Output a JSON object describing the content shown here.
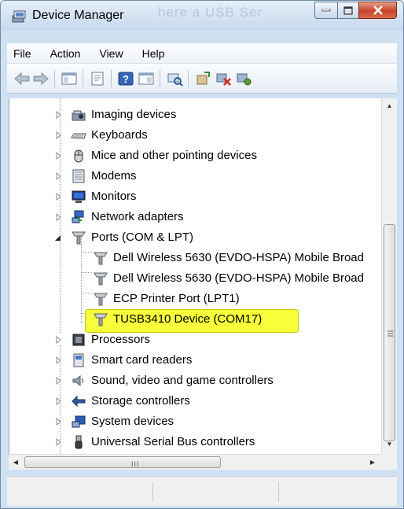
{
  "window": {
    "title": "Device Manager",
    "title_ghost": "here a USB Ser",
    "controls": {
      "minimize_icon": "minimize-icon",
      "maximize_icon": "maximize-icon",
      "close_icon": "close-icon"
    }
  },
  "menu": [
    "File",
    "Action",
    "View",
    "Help"
  ],
  "toolbar_icons": [
    "back-arrow-icon",
    "forward-arrow-icon",
    "show-hide-tree-icon",
    "properties-icon",
    "help-icon",
    "action-pane-icon",
    "scan-hardware-icon",
    "update-driver-icon",
    "disable-device-icon",
    "uninstall-device-icon"
  ],
  "tree": {
    "items": [
      {
        "label": "Imaging devices",
        "icon": "imaging-device-icon",
        "level": 1,
        "expanded": false
      },
      {
        "label": "Keyboards",
        "icon": "keyboard-icon",
        "level": 1,
        "expanded": false
      },
      {
        "label": "Mice and other pointing devices",
        "icon": "mouse-icon",
        "level": 1,
        "expanded": false
      },
      {
        "label": "Modems",
        "icon": "modem-icon",
        "level": 1,
        "expanded": false
      },
      {
        "label": "Monitors",
        "icon": "monitor-icon",
        "level": 1,
        "expanded": false
      },
      {
        "label": "Network adapters",
        "icon": "network-adapter-icon",
        "level": 1,
        "expanded": false
      },
      {
        "label": "Ports (COM & LPT)",
        "icon": "port-icon",
        "level": 1,
        "expanded": true
      },
      {
        "label": "Dell Wireless 5630 (EVDO-HSPA) Mobile Broad",
        "icon": "port-icon",
        "level": 2
      },
      {
        "label": "Dell Wireless 5630 (EVDO-HSPA) Mobile Broad",
        "icon": "port-icon",
        "level": 2
      },
      {
        "label": "ECP Printer Port (LPT1)",
        "icon": "port-icon",
        "level": 2
      },
      {
        "label": "TUSB3410 Device (COM17)",
        "icon": "port-icon",
        "level": 2,
        "highlighted": true
      },
      {
        "label": "Processors",
        "icon": "processor-icon",
        "level": 1,
        "expanded": false
      },
      {
        "label": "Smart card readers",
        "icon": "smart-card-reader-icon",
        "level": 1,
        "expanded": false
      },
      {
        "label": "Sound, video and game controllers",
        "icon": "sound-icon",
        "level": 1,
        "expanded": false
      },
      {
        "label": "Storage controllers",
        "icon": "storage-controller-icon",
        "level": 1,
        "expanded": false
      },
      {
        "label": "System devices",
        "icon": "system-device-icon",
        "level": 1,
        "expanded": false
      },
      {
        "label": "Universal Serial Bus controllers",
        "icon": "usb-icon",
        "level": 1,
        "expanded": false
      }
    ]
  },
  "scrollbar": {
    "grip": "III"
  },
  "colors": {
    "highlight": "#f6ff3a",
    "titlebar": "#c7d9ec",
    "close_button": "#c8432a"
  }
}
